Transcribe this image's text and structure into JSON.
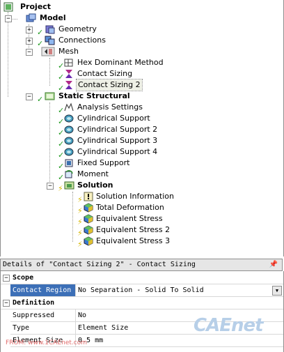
{
  "tree": {
    "project": "Project",
    "model": "Model",
    "geometry": "Geometry",
    "connections": "Connections",
    "mesh": "Mesh",
    "hex_dominant": "Hex Dominant Method",
    "contact_sizing": "Contact Sizing",
    "contact_sizing_2": "Contact Sizing 2",
    "static_structural": "Static Structural",
    "analysis_settings": "Analysis Settings",
    "cyl_support_1": "Cylindrical Support",
    "cyl_support_2": "Cylindrical Support 2",
    "cyl_support_3": "Cylindrical Support 3",
    "cyl_support_4": "Cylindrical Support 4",
    "fixed_support": "Fixed Support",
    "moment": "Moment",
    "solution": "Solution",
    "solution_information": "Solution Information",
    "total_deformation": "Total Deformation",
    "equivalent_stress": "Equivalent Stress",
    "equivalent_stress_2": "Equivalent Stress 2",
    "equivalent_stress_3": "Equivalent Stress 3"
  },
  "details": {
    "header": "Details of \"Contact Sizing 2\" - Contact Sizing",
    "scope_label": "Scope",
    "contact_region_key": "Contact Region",
    "contact_region_value": "No Separation - Solid To Solid",
    "definition_label": "Definition",
    "suppressed_key": "Suppressed",
    "suppressed_value": "No",
    "type_key": "Type",
    "type_value": "Element Size",
    "element_size_key": "Element Size",
    "element_size_value": "0.5 mm"
  },
  "watermark": "CAEnet",
  "footer": "FROM: www.1CAEnet.com",
  "colors": {
    "selection": "#3c6fb7",
    "check": "#1f9a1f",
    "pending": "#d6b800"
  }
}
